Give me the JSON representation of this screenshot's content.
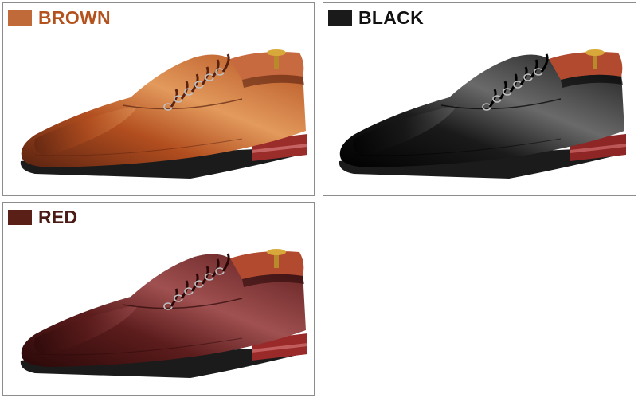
{
  "variants": [
    {
      "label": "BROWN",
      "swatch_color": "#bf6a38",
      "text_color": "#b4521e",
      "icon": "brown-oxford-shoe",
      "shoe": {
        "upper": "#b24e1f",
        "upper_light": "#e39a5c",
        "upper_dark": "#5a2210",
        "lining": "#c86a3f",
        "heel": "#9a2c2a",
        "heel_stripe": "#d07070"
      }
    },
    {
      "label": "BLACK",
      "swatch_color": "#1a1a1a",
      "text_color": "#111111",
      "icon": "black-oxford-shoe",
      "shoe": {
        "upper": "#1a1a1a",
        "upper_light": "#6a6a6a",
        "upper_dark": "#000000",
        "lining": "#b24a30",
        "heel": "#8e2626",
        "heel_stripe": "#c86464"
      }
    },
    {
      "label": "RED",
      "swatch_color": "#5a2018",
      "text_color": "#4a1a14",
      "icon": "red-oxford-shoe",
      "shoe": {
        "upper": "#5c1c1c",
        "upper_light": "#a05050",
        "upper_dark": "#2a0808",
        "lining": "#b24a30",
        "heel": "#9a2a2a",
        "heel_stripe": "#cc6a6a"
      }
    }
  ]
}
